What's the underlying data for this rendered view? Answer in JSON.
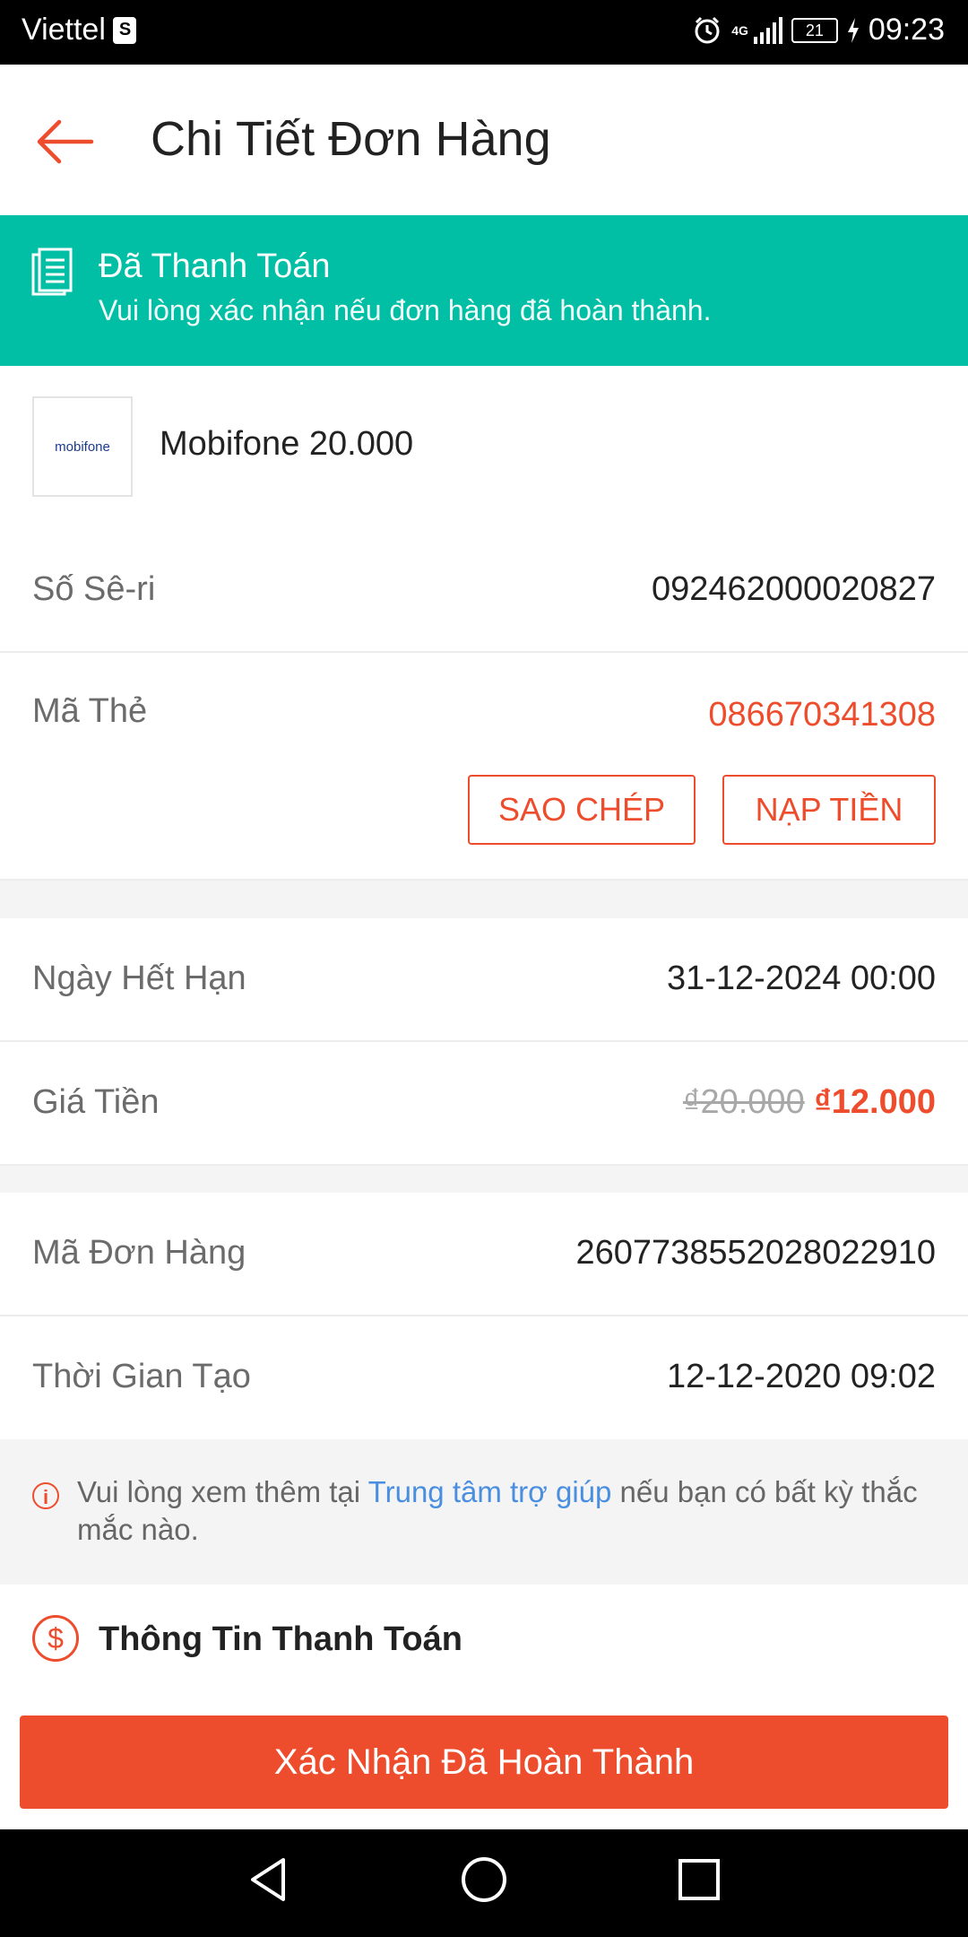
{
  "status_bar": {
    "carrier": "Viettel",
    "network": "4G",
    "battery": "21",
    "time": "09:23"
  },
  "header": {
    "title": "Chi Tiết Đơn Hàng"
  },
  "banner": {
    "title": "Đã Thanh Toán",
    "subtitle": "Vui lòng xác nhận nếu đơn hàng đã hoàn thành."
  },
  "product": {
    "logo_text": "mobifone",
    "name": "Mobifone 20.000"
  },
  "serial": {
    "label": "Số Sê-ri",
    "value": "092462000020827"
  },
  "card_code": {
    "label": "Mã Thẻ",
    "value": "086670341308",
    "copy_label": "SAO CHÉP",
    "topup_label": "NẠP TIỀN"
  },
  "expiry": {
    "label": "Ngày Hết Hạn",
    "value": "31-12-2024 00:00"
  },
  "price": {
    "label": "Giá Tiền",
    "original": "₫20.000",
    "discounted": "₫12.000"
  },
  "order_id": {
    "label": "Mã Đơn Hàng",
    "value": "2607738552028022910"
  },
  "created": {
    "label": "Thời Gian Tạo",
    "value": "12-12-2020 09:02"
  },
  "help": {
    "prefix": "Vui lòng xem thêm tại ",
    "link": "Trung tâm trợ giúp",
    "suffix": " nếu bạn có bất kỳ thắc mắc nào."
  },
  "payment": {
    "title": "Thông Tin Thanh Toán"
  },
  "confirm_button": {
    "label": "Xác Nhận Đã Hoàn Thành"
  },
  "colors": {
    "accent": "#ee4d2d",
    "banner": "#00bfa5",
    "link": "#4a8ee0"
  }
}
